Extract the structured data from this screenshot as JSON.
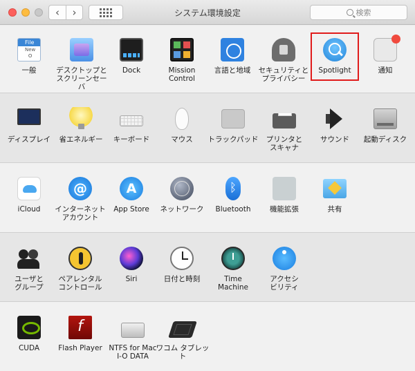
{
  "window": {
    "title": "システム環境設定",
    "search_placeholder": "検索"
  },
  "toolbar": {
    "back_label": "‹",
    "forward_label": "›"
  },
  "sections": [
    {
      "items": [
        {
          "label": "一般",
          "icon": "general-icon"
        },
        {
          "label": "デスクトップと\nスクリーンセーバ",
          "icon": "desktop-screensaver-icon"
        },
        {
          "label": "Dock",
          "icon": "dock-icon"
        },
        {
          "label": "Mission\nControl",
          "icon": "mission-control-icon"
        },
        {
          "label": "言語と地域",
          "icon": "language-region-icon"
        },
        {
          "label": "セキュリティと\nプライバシー",
          "icon": "security-privacy-icon"
        },
        {
          "label": "Spotlight",
          "icon": "spotlight-icon",
          "highlighted": true
        },
        {
          "label": "通知",
          "icon": "notifications-icon"
        }
      ]
    },
    {
      "items": [
        {
          "label": "ディスプレイ",
          "icon": "display-icon"
        },
        {
          "label": "省エネルギー",
          "icon": "energy-saver-icon"
        },
        {
          "label": "キーボード",
          "icon": "keyboard-icon"
        },
        {
          "label": "マウス",
          "icon": "mouse-icon"
        },
        {
          "label": "トラックパッド",
          "icon": "trackpad-icon"
        },
        {
          "label": "プリンタと\nスキャナ",
          "icon": "printer-scanner-icon"
        },
        {
          "label": "サウンド",
          "icon": "sound-icon"
        },
        {
          "label": "起動ディスク",
          "icon": "startup-disk-icon"
        }
      ]
    },
    {
      "items": [
        {
          "label": "iCloud",
          "icon": "icloud-icon"
        },
        {
          "label": "インターネット\nアカウント",
          "icon": "internet-accounts-icon"
        },
        {
          "label": "App Store",
          "icon": "app-store-icon"
        },
        {
          "label": "ネットワーク",
          "icon": "network-icon"
        },
        {
          "label": "Bluetooth",
          "icon": "bluetooth-icon"
        },
        {
          "label": "機能拡張",
          "icon": "extensions-icon"
        },
        {
          "label": "共有",
          "icon": "sharing-icon"
        }
      ]
    },
    {
      "items": [
        {
          "label": "ユーザと\nグループ",
          "icon": "users-groups-icon"
        },
        {
          "label": "ペアレンタル\nコントロール",
          "icon": "parental-controls-icon"
        },
        {
          "label": "Siri",
          "icon": "siri-icon"
        },
        {
          "label": "日付と時刻",
          "icon": "date-time-icon"
        },
        {
          "label": "Time\nMachine",
          "icon": "time-machine-icon"
        },
        {
          "label": "アクセシ\nビリティ",
          "icon": "accessibility-icon"
        }
      ]
    },
    {
      "items": [
        {
          "label": "CUDA",
          "icon": "cuda-icon"
        },
        {
          "label": "Flash Player",
          "icon": "flash-player-icon"
        },
        {
          "label": "NTFS for Mac\nI-O DATA",
          "icon": "ntfs-for-mac-icon"
        },
        {
          "label": "ワコム タブレット",
          "icon": "wacom-tablet-icon"
        }
      ]
    }
  ],
  "colors": {
    "highlight_border": "#e01b1b",
    "close": "#fc605c",
    "minimize": "#fdbc40",
    "zoom": "#c8c8c8"
  }
}
